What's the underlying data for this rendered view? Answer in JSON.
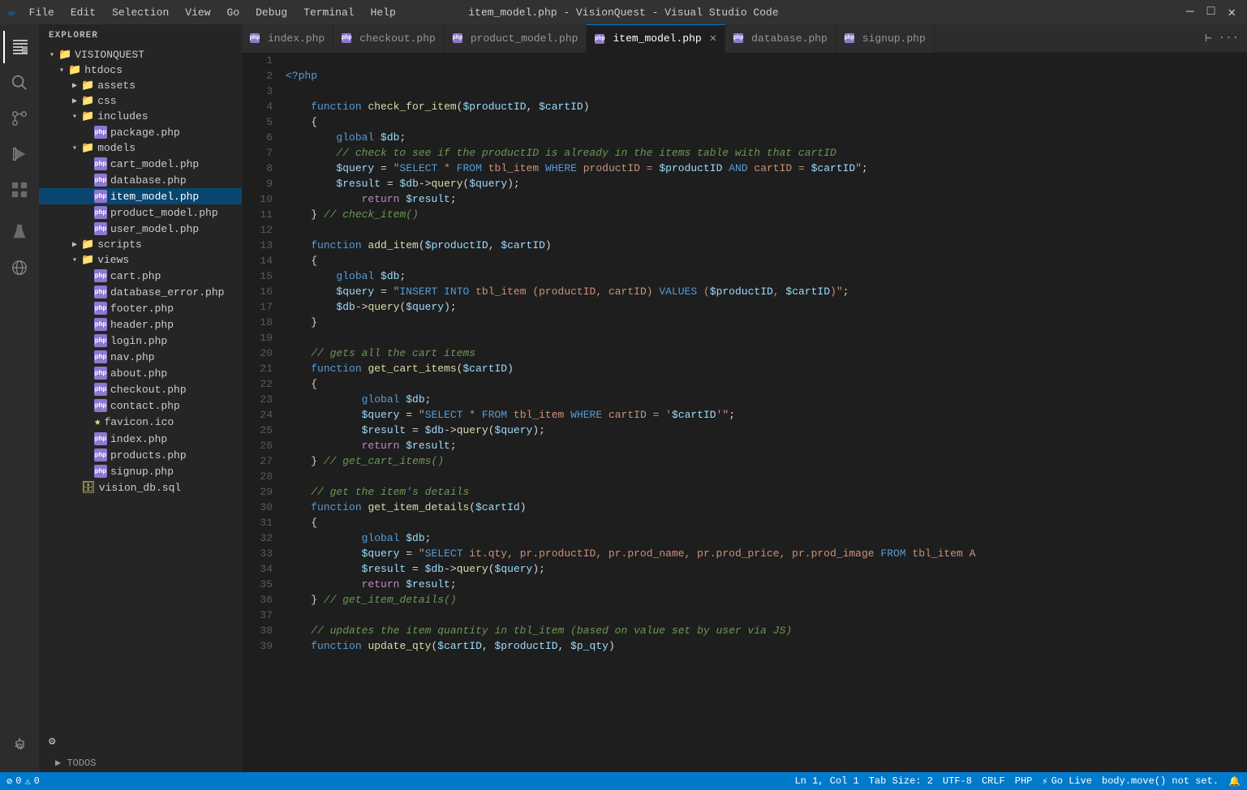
{
  "titleBar": {
    "title": "item_model.php - VisionQuest - Visual Studio Code",
    "menuItems": [
      "File",
      "Edit",
      "Selection",
      "View",
      "Go",
      "Debug",
      "Terminal",
      "Help"
    ],
    "windowControls": [
      "—",
      "□",
      "×"
    ]
  },
  "activityBar": {
    "icons": [
      {
        "name": "explorer-icon",
        "symbol": "⎘",
        "active": true
      },
      {
        "name": "search-icon",
        "symbol": "🔍",
        "active": false
      },
      {
        "name": "source-control-icon",
        "symbol": "⑂",
        "active": false
      },
      {
        "name": "debug-icon",
        "symbol": "▷",
        "active": false
      },
      {
        "name": "extensions-icon",
        "symbol": "⊞",
        "active": false
      },
      {
        "name": "test-icon",
        "symbol": "⚗",
        "active": false
      },
      {
        "name": "remote-icon",
        "symbol": "◎",
        "active": false
      }
    ],
    "bottomIcons": [
      {
        "name": "settings-icon",
        "symbol": "⚙"
      },
      {
        "name": "account-icon",
        "symbol": "👤"
      }
    ]
  },
  "sidebar": {
    "header": "EXPLORER",
    "tree": {
      "root": "VISIONQUEST",
      "items": [
        {
          "id": "htdocs",
          "label": "htdocs",
          "type": "folder",
          "level": 1,
          "expanded": true
        },
        {
          "id": "assets",
          "label": "assets",
          "type": "folder",
          "level": 2,
          "expanded": false
        },
        {
          "id": "css",
          "label": "css",
          "type": "folder",
          "level": 2,
          "expanded": false
        },
        {
          "id": "includes",
          "label": "includes",
          "type": "folder",
          "level": 2,
          "expanded": true
        },
        {
          "id": "package.php",
          "label": "package.php",
          "type": "php",
          "level": 3
        },
        {
          "id": "models",
          "label": "models",
          "type": "folder-special",
          "level": 2,
          "expanded": true
        },
        {
          "id": "cart_model.php",
          "label": "cart_model.php",
          "type": "php",
          "level": 3
        },
        {
          "id": "database.php",
          "label": "database.php",
          "type": "php",
          "level": 3
        },
        {
          "id": "item_model.php",
          "label": "item_model.php",
          "type": "php",
          "level": 3,
          "active": true
        },
        {
          "id": "product_model.php",
          "label": "product_model.php",
          "type": "php",
          "level": 3
        },
        {
          "id": "user_model.php",
          "label": "user_model.php",
          "type": "php",
          "level": 3
        },
        {
          "id": "scripts",
          "label": "scripts",
          "type": "folder",
          "level": 2,
          "expanded": false
        },
        {
          "id": "views",
          "label": "views",
          "type": "folder",
          "level": 2,
          "expanded": true
        },
        {
          "id": "cart.php",
          "label": "cart.php",
          "type": "php",
          "level": 3
        },
        {
          "id": "database_error.php",
          "label": "database_error.php",
          "type": "php",
          "level": 3
        },
        {
          "id": "footer.php",
          "label": "footer.php",
          "type": "php",
          "level": 3
        },
        {
          "id": "header.php",
          "label": "header.php",
          "type": "php",
          "level": 3
        },
        {
          "id": "login.php",
          "label": "login.php",
          "type": "php",
          "level": 3
        },
        {
          "id": "nav.php",
          "label": "nav.php",
          "type": "php",
          "level": 3
        },
        {
          "id": "about.php",
          "label": "about.php",
          "type": "php",
          "level": 3
        },
        {
          "id": "checkout.php",
          "label": "checkout.php",
          "type": "php",
          "level": 3
        },
        {
          "id": "contact.php",
          "label": "contact.php",
          "type": "php",
          "level": 3
        },
        {
          "id": "favicon.ico",
          "label": "favicon.ico",
          "type": "star",
          "level": 3
        },
        {
          "id": "index.php",
          "label": "index.php",
          "type": "php",
          "level": 3
        },
        {
          "id": "products.php",
          "label": "products.php",
          "type": "php",
          "level": 3
        },
        {
          "id": "signup.php",
          "label": "signup.php",
          "type": "php",
          "level": 3
        },
        {
          "id": "vision_db.sql",
          "label": "vision_db.sql",
          "type": "db",
          "level": 2
        }
      ]
    },
    "todos": "TODOS"
  },
  "tabs": [
    {
      "label": "index.php",
      "active": false,
      "dirty": false
    },
    {
      "label": "checkout.php",
      "active": false,
      "dirty": false
    },
    {
      "label": "product_model.php",
      "active": false,
      "dirty": false
    },
    {
      "label": "item_model.php",
      "active": true,
      "dirty": false,
      "closeable": true
    },
    {
      "label": "database.php",
      "active": false,
      "dirty": false
    },
    {
      "label": "signup.php",
      "active": false,
      "dirty": false
    }
  ],
  "codeLines": [
    {
      "num": 1,
      "content": ""
    },
    {
      "num": 2,
      "content": "<?php"
    },
    {
      "num": 3,
      "content": ""
    },
    {
      "num": 4,
      "content": "    function check_for_item($productID, $cartID)"
    },
    {
      "num": 5,
      "content": "    {"
    },
    {
      "num": 6,
      "content": "        global $db;"
    },
    {
      "num": 7,
      "content": "        // check to see if the productID is already in the items table with that cartID"
    },
    {
      "num": 8,
      "content": "        $query = \"SELECT * FROM tbl_item WHERE productID = $productID AND cartID = $cartID\";"
    },
    {
      "num": 9,
      "content": "        $result = $db->query($query);"
    },
    {
      "num": 10,
      "content": "            return $result;"
    },
    {
      "num": 11,
      "content": "    } // check_item()"
    },
    {
      "num": 12,
      "content": ""
    },
    {
      "num": 13,
      "content": "    function add_item($productID, $cartID)"
    },
    {
      "num": 14,
      "content": "    {"
    },
    {
      "num": 15,
      "content": "        global $db;"
    },
    {
      "num": 16,
      "content": "        $query = \"INSERT INTO tbl_item (productID, cartID) VALUES ($productID, $cartID)\";"
    },
    {
      "num": 17,
      "content": "        $db->query($query);"
    },
    {
      "num": 18,
      "content": "    }"
    },
    {
      "num": 19,
      "content": ""
    },
    {
      "num": 20,
      "content": "    // gets all the cart items"
    },
    {
      "num": 21,
      "content": "    function get_cart_items($cartID)"
    },
    {
      "num": 22,
      "content": "    {"
    },
    {
      "num": 23,
      "content": "            global $db;"
    },
    {
      "num": 24,
      "content": "            $query = \"SELECT * FROM tbl_item WHERE cartID = '$cartID'\";"
    },
    {
      "num": 25,
      "content": "            $result = $db->query($query);"
    },
    {
      "num": 26,
      "content": "            return $result;"
    },
    {
      "num": 27,
      "content": "    } // get_cart_items()"
    },
    {
      "num": 28,
      "content": ""
    },
    {
      "num": 29,
      "content": "    // get the item's details"
    },
    {
      "num": 30,
      "content": "    function get_item_details($cartId)"
    },
    {
      "num": 31,
      "content": "    {"
    },
    {
      "num": 32,
      "content": "            global $db;"
    },
    {
      "num": 33,
      "content": "            $query = \"SELECT it.qty, pr.productID, pr.prod_name, pr.prod_price, pr.prod_image FROM tbl_item A"
    },
    {
      "num": 34,
      "content": "            $result = $db->query($query);"
    },
    {
      "num": 35,
      "content": "            return $result;"
    },
    {
      "num": 36,
      "content": "    } // get_item_details()"
    },
    {
      "num": 37,
      "content": ""
    },
    {
      "num": 38,
      "content": "    // updates the item quantity in tbl_item (based on value set by user via JS)"
    },
    {
      "num": 39,
      "content": "    function update_qty($cartID, $productID, $p_qty)"
    }
  ],
  "statusBar": {
    "left": {
      "errors": "0",
      "warnings": "0",
      "branchIcon": "⎇",
      "branch": ""
    },
    "center": {
      "position": "Ln 1, Col 1",
      "tabSize": "Tab Size: 2",
      "encoding": "UTF-8",
      "lineEnding": "CRLF",
      "language": "PHP"
    },
    "right": {
      "goLive": "Go Live",
      "message": "body.move() not set.",
      "bellIcon": "🔔"
    }
  },
  "colors": {
    "accent": "#007acc",
    "background": "#1e1e1e",
    "sidebar": "#252526",
    "tabActive": "#1e1e1e",
    "tabInactive": "#2d2d2d"
  }
}
